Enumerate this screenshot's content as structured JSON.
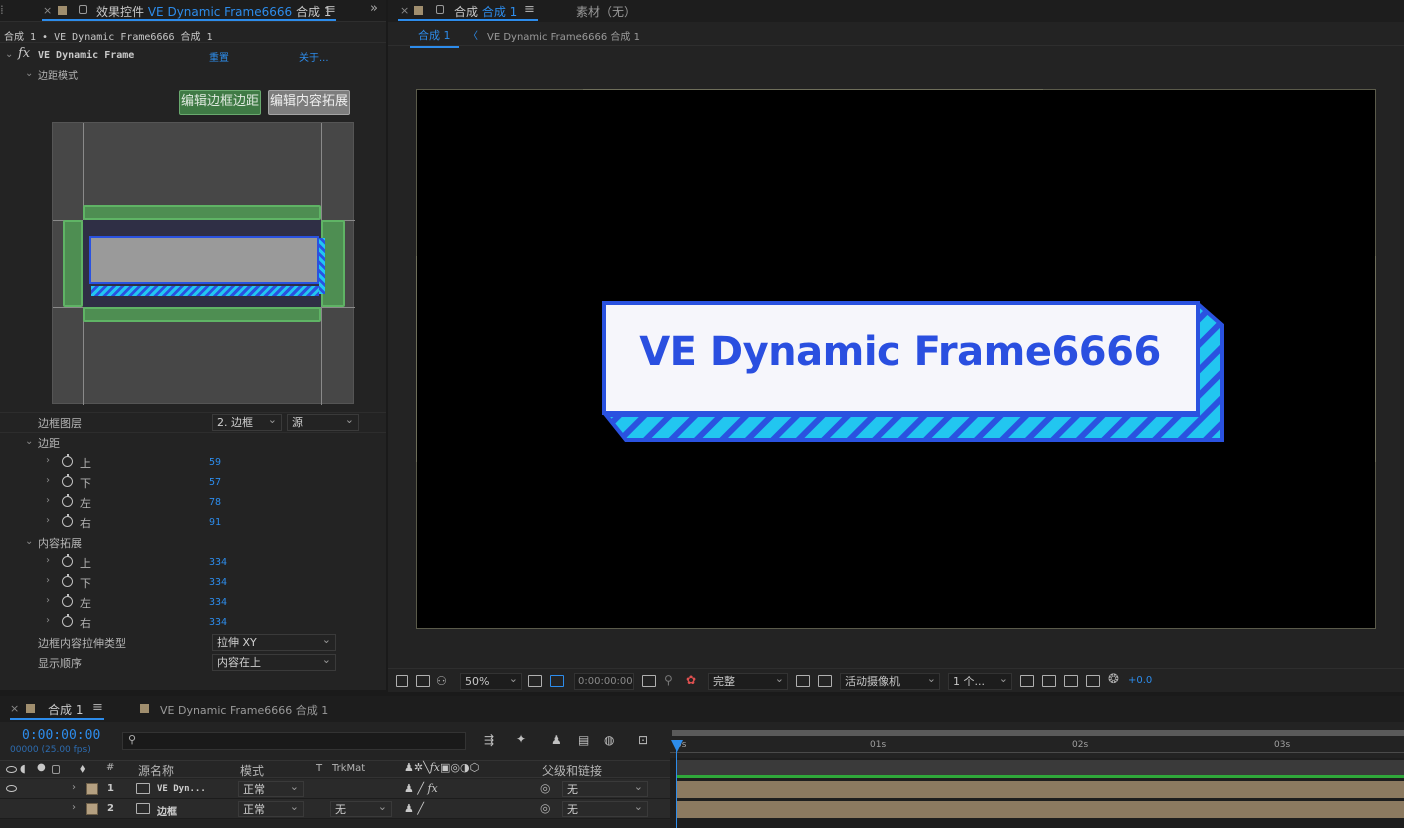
{
  "effect_panel": {
    "tab_close": "×",
    "tab_title_prefix": "效果控件",
    "tab_title_layer": "VE Dynamic Frame6666",
    "tab_title_comp": "合成 1",
    "menu": "≡",
    "expand": "»",
    "crumb": "合成 1 • VE Dynamic Frame6666  合成 1",
    "fx_label": "fx",
    "effect_name": "VE Dynamic Frame",
    "reset": "重置",
    "about": "关于...",
    "margin_mode": "边距模式",
    "btn_edit_margin": "编辑边框边距",
    "btn_edit_content": "编辑内容拓展",
    "frame_layer_label": "边框图层",
    "frame_layer_value": "2. 边框",
    "frame_layer_source": "源",
    "margin_group": "边距",
    "margin": [
      {
        "label": "上",
        "value": "59"
      },
      {
        "label": "下",
        "value": "57"
      },
      {
        "label": "左",
        "value": "78"
      },
      {
        "label": "右",
        "value": "91"
      }
    ],
    "content_group": "内容拓展",
    "content": [
      {
        "label": "上",
        "value": "334"
      },
      {
        "label": "下",
        "value": "334"
      },
      {
        "label": "左",
        "value": "334"
      },
      {
        "label": "右",
        "value": "334"
      }
    ],
    "stretch_label": "边框内容拉伸类型",
    "stretch_value": "拉伸 XY",
    "order_label": "显示顺序",
    "order_value": "内容在上"
  },
  "viewer": {
    "tab_close": "×",
    "tab_prefix": "合成",
    "tab_comp": "合成 1",
    "menu": "≡",
    "footage_tab": "素材（无）",
    "crumb_active": "合成 1",
    "crumb_arrow": "〈",
    "crumb_layer": "VE Dynamic Frame6666  合成 1",
    "frame_text": "VE Dynamic Frame6666",
    "zoom": "50%",
    "timecode": "0:00:00:00",
    "quality": "完整",
    "camera": "活动摄像机",
    "views": "1 个...",
    "exposure": "+0.0"
  },
  "timeline": {
    "tab_close": "×",
    "tab_comp": "合成 1",
    "menu": "≡",
    "tab2": "VE Dynamic Frame6666 合成 1",
    "timecode": "0:00:00:00",
    "fps": "00000 (25.00 fps)",
    "search_placeholder": "",
    "ruler": [
      "0s",
      "01s",
      "02s",
      "03s"
    ],
    "headers": {
      "hash": "#",
      "source": "源名称",
      "mode": "模式",
      "t": "T",
      "trkmat": "TrkMat",
      "parent": "父级和链接"
    },
    "layers": [
      {
        "num": "1",
        "name": "VE Dyn...",
        "mode": "正常",
        "trkmat": "",
        "parent": "无"
      },
      {
        "num": "2",
        "name": "边框",
        "mode": "正常",
        "trkmat": "无",
        "parent": "无"
      }
    ]
  },
  "colors": {
    "accent": "#2d8ceb",
    "frame_blue": "#2a52e0",
    "frame_cyan": "#22c6f0",
    "green_button": "#3f7a45",
    "layer_bar": "#8c7a60"
  }
}
